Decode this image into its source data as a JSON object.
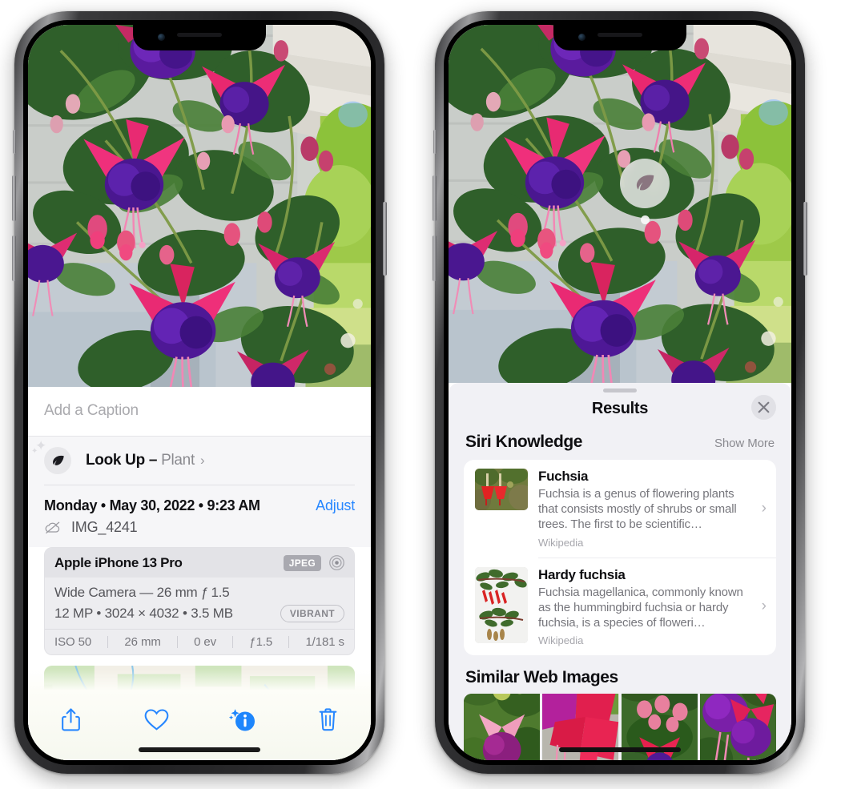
{
  "left_phone": {
    "photo_alt": "fuchsia-flowers-photo",
    "caption_placeholder": "Add a Caption",
    "look_up": {
      "icon": "leaf-icon",
      "label": "Look Up – ",
      "subject": "Plant",
      "chevron": "›"
    },
    "meta": {
      "date": "Monday • May 30, 2022 • 9:23 AM",
      "adjust_label": "Adjust",
      "cloud_icon": "cloud-slash-icon",
      "filename": "IMG_4241"
    },
    "exif": {
      "model": "Apple iPhone 13 Pro",
      "format_badge": "JPEG",
      "aperture_icon": "aperture-icon",
      "lens_line": "Wide Camera — 26 mm ƒ 1.5",
      "size_line": "12 MP • 3024 × 4032 • 3.5 MB",
      "style_badge": "VIBRANT",
      "stats": [
        "ISO 50",
        "26 mm",
        "0 ev",
        "ƒ1.5",
        "1/181 s"
      ]
    },
    "map": {
      "name": "location-map",
      "pin": "photo-thumbnail-pin"
    },
    "toolbar": [
      {
        "name": "share-button",
        "icon": "share-icon"
      },
      {
        "name": "favorite-button",
        "icon": "heart-icon"
      },
      {
        "name": "info-button",
        "icon": "info-sparkle-icon"
      },
      {
        "name": "delete-button",
        "icon": "trash-icon"
      }
    ]
  },
  "right_phone": {
    "photo_alt": "fuchsia-flowers-photo",
    "visual_lookup_badge": {
      "icon": "leaf-icon",
      "name": "visual-look-up-badge"
    },
    "sheet": {
      "title": "Results",
      "close_icon": "close-icon",
      "sections": [
        {
          "title": "Siri Knowledge",
          "action": "Show More",
          "cards": [
            {
              "title": "Fuchsia",
              "description": "Fuchsia is a genus of flowering plants that consists mostly of shrubs or small trees. The first to be scientific…",
              "source": "Wikipedia",
              "thumb": "fuchsia-red-flowers-thumb"
            },
            {
              "title": "Hardy fuchsia",
              "description": "Fuchsia magellanica, commonly known as the hummingbird fuchsia or hardy fuchsia, is a species of floweri…",
              "source": "Wikipedia",
              "thumb": "hardy-fuchsia-specimen-thumb"
            }
          ]
        },
        {
          "title": "Similar Web Images",
          "images": [
            "fuchsia-web-image-1",
            "fuchsia-web-image-2",
            "fuchsia-web-image-3",
            "fuchsia-web-image-4"
          ]
        }
      ]
    }
  },
  "colors": {
    "accent_blue": "#2787ff",
    "sheet_bg": "#f1f1f5",
    "card_bg": "#ffffff",
    "secondary_text": "#76767c"
  }
}
